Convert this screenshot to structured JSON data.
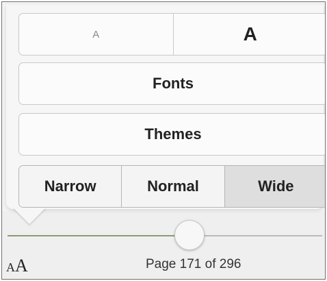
{
  "font_size": {
    "smaller_label": "A",
    "larger_label": "A"
  },
  "menu": {
    "fonts_label": "Fonts",
    "themes_label": "Themes"
  },
  "page_width": {
    "options": [
      "Narrow",
      "Normal",
      "Wide"
    ],
    "selected": "Wide"
  },
  "bottom_bar": {
    "text_size_icon_letters": "AA",
    "page_label": "Page 171 of 296",
    "current_page": 171,
    "total_pages": 296,
    "progress_fraction": 0.578
  },
  "colors": {
    "slider_fill": "#8c9c6e",
    "selected_segment": "#dedede"
  }
}
